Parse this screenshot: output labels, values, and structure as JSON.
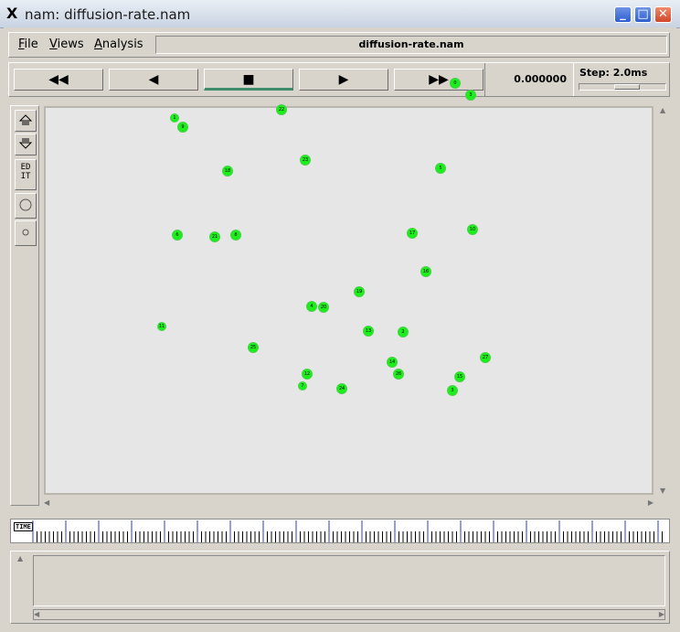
{
  "window": {
    "title": "nam: diffusion-rate.nam",
    "title_icon": "x-logo-icon",
    "controls": [
      "minimize-icon",
      "maximize-icon",
      "close-icon"
    ]
  },
  "menu": {
    "items": [
      "File",
      "Views",
      "Analysis"
    ],
    "filename": "diffusion-rate.nam"
  },
  "playback": {
    "buttons": [
      {
        "icon": "fast-rewind-icon",
        "glyph": "◀◀"
      },
      {
        "icon": "rewind-icon",
        "glyph": "◀"
      },
      {
        "icon": "stop-icon",
        "glyph": "■"
      },
      {
        "icon": "play-icon",
        "glyph": "▶"
      },
      {
        "icon": "fast-forward-icon",
        "glyph": "▶▶"
      }
    ],
    "time": "0.000000",
    "step_label": "Step: 2.0ms"
  },
  "tools": {
    "zoom_in_icon": "zoom-in-icon",
    "zoom_out_icon": "zoom-out-icon",
    "edit_label": "EDIT",
    "circle_icon": "circle-icon",
    "dot_icon": "dot-icon"
  },
  "timeline": {
    "tag": "TIME"
  },
  "nodes": [
    {
      "label": "0"
    },
    {
      "label": "3"
    },
    {
      "label": "22"
    },
    {
      "label": "1"
    },
    {
      "label": "9"
    },
    {
      "label": "23"
    },
    {
      "label": "18"
    },
    {
      "label": "5"
    },
    {
      "label": "6"
    },
    {
      "label": "21"
    },
    {
      "label": "8"
    },
    {
      "label": "17"
    },
    {
      "label": "10"
    },
    {
      "label": "16"
    },
    {
      "label": "19"
    },
    {
      "label": "4"
    },
    {
      "label": "20"
    },
    {
      "label": "11"
    },
    {
      "label": "13"
    },
    {
      "label": "2"
    },
    {
      "label": "25"
    },
    {
      "label": "27"
    },
    {
      "label": "14"
    },
    {
      "label": "12"
    },
    {
      "label": "26"
    },
    {
      "label": "15"
    },
    {
      "label": "7"
    },
    {
      "label": "24"
    },
    {
      "label": "3"
    }
  ],
  "colors": {
    "node_fill": "#1aef1a",
    "canvas_bg": "#e6e6e6",
    "active_underline": "#3d8c6a"
  }
}
